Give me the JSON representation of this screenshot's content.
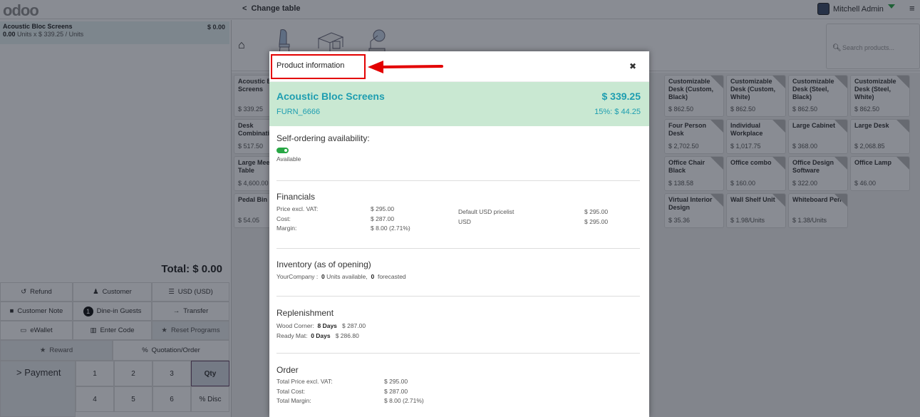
{
  "topbar": {
    "logo": "odoo",
    "change_table_label": "Change table",
    "user_name": "Mitchell Admin"
  },
  "order": {
    "lines": [
      {
        "name": "Acoustic Bloc Screens",
        "qty": "0.00",
        "unit_detail": "Units x $ 339.25 / Units",
        "price": "$ 0.00"
      }
    ],
    "total": "Total: $ 0.00"
  },
  "controls": {
    "refund": "Refund",
    "customer": "Customer",
    "pricelist": "USD (USD)",
    "customer_note": "Customer Note",
    "guests_count": "1",
    "guests": "Dine-in Guests",
    "transfer": "Transfer",
    "ewallet": "eWallet",
    "enter_code": "Enter Code",
    "reset_programs": "Reset Programs",
    "reward": "Reward",
    "quotation": "Quotation/Order",
    "payment": "Payment"
  },
  "numpad": [
    "1",
    "2",
    "3",
    "Qty",
    "4",
    "5",
    "6",
    "% Disc"
  ],
  "search": {
    "placeholder": "Search products..."
  },
  "products": [
    {
      "name": "Acoustic Bloc Screens",
      "price": "$ 339.25"
    },
    {
      "name": "Desk Combination",
      "price": "$ 517.50"
    },
    {
      "name": "Large Meeting Table",
      "price": "$ 4,600.00"
    },
    {
      "name": "Pedal Bin",
      "price": "$ 54.05"
    },
    {
      "name": "Customizable Desk (Custom, Black)",
      "price": "$ 862.50"
    },
    {
      "name": "Customizable Desk (Custom, White)",
      "price": "$ 862.50"
    },
    {
      "name": "Customizable Desk (Steel, Black)",
      "price": "$ 862.50"
    },
    {
      "name": "Customizable Desk (Steel, White)",
      "price": "$ 862.50"
    },
    {
      "name": "Four Person Desk",
      "price": "$ 2,702.50"
    },
    {
      "name": "Individual Workplace",
      "price": "$ 1,017.75"
    },
    {
      "name": "Large Cabinet",
      "price": "$ 368.00"
    },
    {
      "name": "Large Desk",
      "price": "$ 2,068.85"
    },
    {
      "name": "Office Chair Black",
      "price": "$ 138.58"
    },
    {
      "name": "Office combo",
      "price": "$ 160.00"
    },
    {
      "name": "Office Design Software",
      "price": "$ 322.00"
    },
    {
      "name": "Office Lamp",
      "price": "$ 46.00"
    },
    {
      "name": "Virtual Interior Design",
      "price": "$ 35.36"
    },
    {
      "name": "Wall Shelf Unit",
      "price": "$ 1.98/Units"
    },
    {
      "name": "Whiteboard Pen",
      "price": "$ 1.38/Units"
    }
  ],
  "modal": {
    "title": "Product information",
    "product_name": "Acoustic Bloc Screens",
    "reference": "FURN_6666",
    "price": "$ 339.25",
    "tax": "15%: $ 44.25",
    "self_ordering": {
      "title": "Self-ordering availability:",
      "status": "Available",
      "enabled": true
    },
    "financials": {
      "title": "Financials",
      "rows": [
        {
          "label": "Price excl. VAT:",
          "value": "$ 295.00"
        },
        {
          "label": "Cost:",
          "value": "$ 287.00"
        },
        {
          "label": "Margin:",
          "value": "$ 8.00 (2.71%)"
        }
      ],
      "pricelists": [
        {
          "label": "Default USD pricelist",
          "value": "$ 295.00"
        },
        {
          "label": "USD",
          "value": "$ 295.00"
        }
      ]
    },
    "inventory": {
      "title": "Inventory (as of opening)",
      "company": "YourCompany :",
      "available": "0",
      "available_label": "Units available,",
      "forecasted": "0",
      "forecasted_label": "forecasted"
    },
    "replenishment": {
      "title": "Replenishment",
      "rows": [
        {
          "vendor": "Wood Corner:",
          "days": "8 Days",
          "price": "$ 287.00"
        },
        {
          "vendor": "Ready Mat:",
          "days": "0 Days",
          "price": "$ 286.80"
        }
      ]
    },
    "order": {
      "title": "Order",
      "rows": [
        {
          "label": "Total Price excl. VAT:",
          "value": "$ 295.00"
        },
        {
          "label": "Total Cost:",
          "value": "$ 287.00"
        },
        {
          "label": "Total Margin:",
          "value": "$ 8.00 (2.71%)"
        }
      ]
    }
  },
  "annotation": {
    "highlight_color": "#e30000"
  }
}
